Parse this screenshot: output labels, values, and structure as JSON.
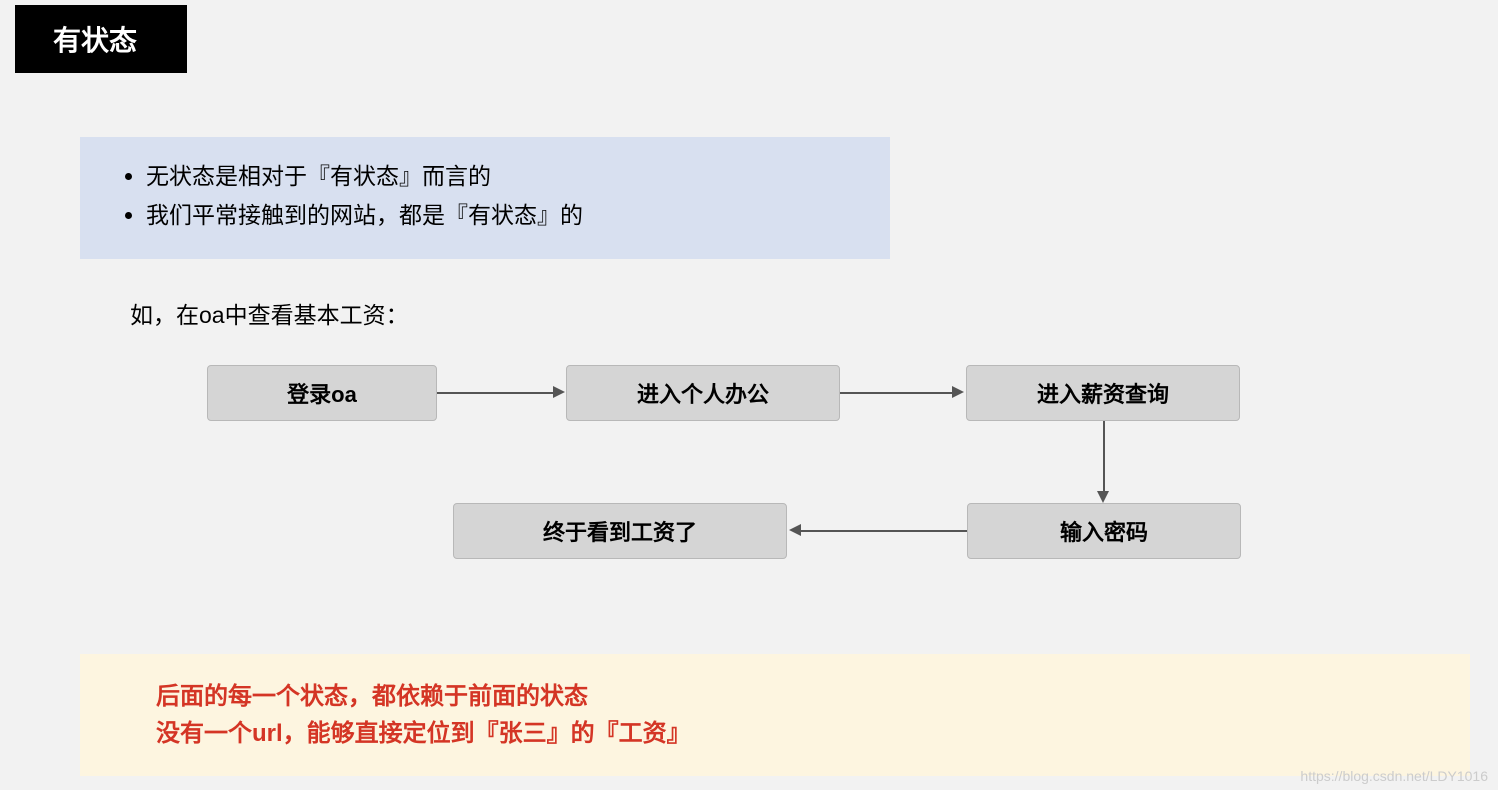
{
  "title": "有状态",
  "intro": {
    "bullets": [
      "无状态是相对于『有状态』而言的",
      "我们平常接触到的网站，都是『有状态』的"
    ]
  },
  "subtitle": "如，在oa中查看基本工资：",
  "flow": {
    "nodes": {
      "n1": "登录oa",
      "n2": "进入个人办公",
      "n3": "进入薪资查询",
      "n4": "输入密码",
      "n5": "终于看到工资了"
    }
  },
  "conclusion": {
    "line1": "后面的每一个状态，都依赖于前面的状态",
    "line2": "没有一个url，能够直接定位到『张三』的『工资』"
  },
  "watermark": "https://blog.csdn.net/LDY1016",
  "chart_data": {
    "type": "flowchart",
    "title": "有状态 — OA 查询工资流程",
    "nodes": [
      {
        "id": "n1",
        "label": "登录oa"
      },
      {
        "id": "n2",
        "label": "进入个人办公"
      },
      {
        "id": "n3",
        "label": "进入薪资查询"
      },
      {
        "id": "n4",
        "label": "输入密码"
      },
      {
        "id": "n5",
        "label": "终于看到工资了"
      }
    ],
    "edges": [
      {
        "from": "n1",
        "to": "n2"
      },
      {
        "from": "n2",
        "to": "n3"
      },
      {
        "from": "n3",
        "to": "n4"
      },
      {
        "from": "n4",
        "to": "n5"
      }
    ],
    "annotations": [
      "后面的每一个状态，都依赖于前面的状态",
      "没有一个url，能够直接定位到『张三』的『工资』"
    ]
  }
}
